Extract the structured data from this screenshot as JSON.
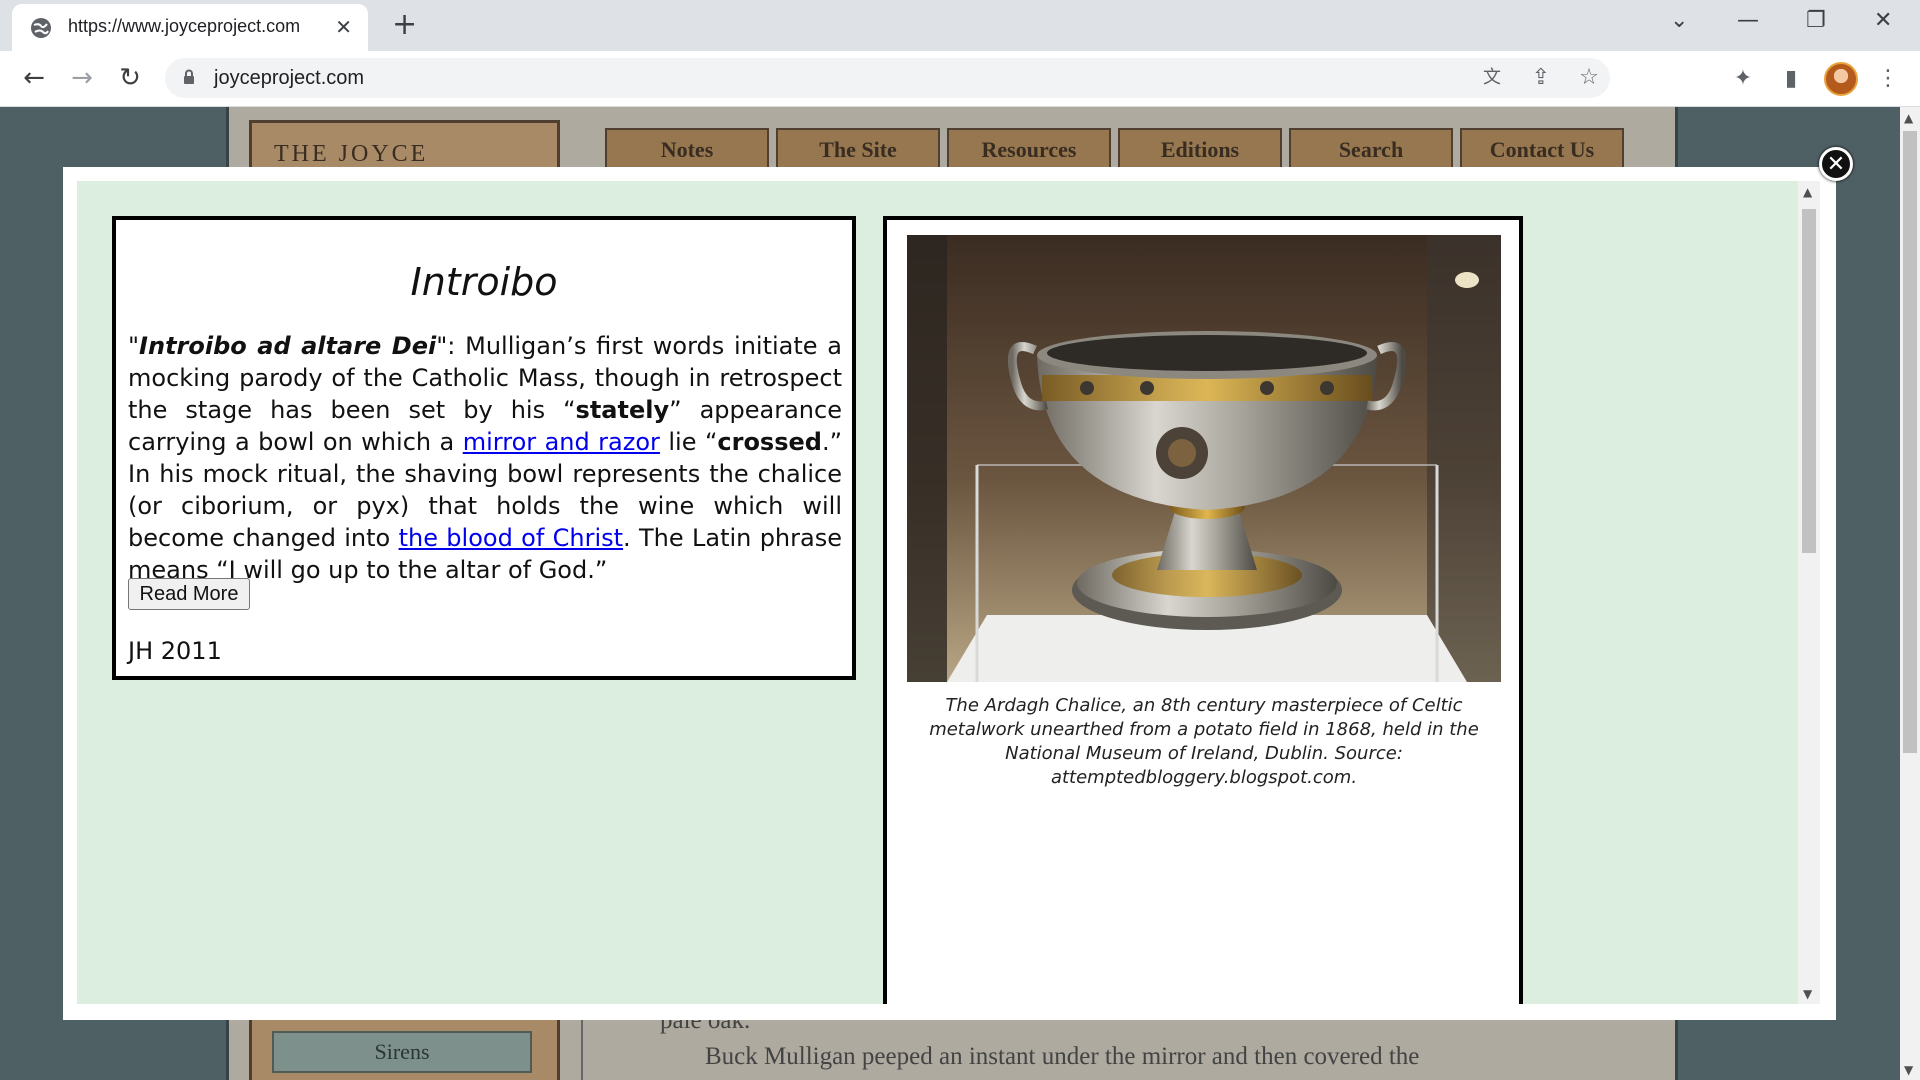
{
  "browser": {
    "tab_title": "https://www.joyceproject.com",
    "tab_close": "✕",
    "new_tab": "+",
    "url": "joyceproject.com",
    "window_controls": {
      "dropdown": "⌄",
      "minimize": "—",
      "restore": "❐",
      "close": "✕"
    },
    "nav": {
      "back": "←",
      "forward": "→",
      "reload": "↻"
    },
    "toolbar_icons": {
      "translate": "文",
      "share": "⇪",
      "bookmark": "☆",
      "extensions": "✦",
      "sidepanel": "▮",
      "menu": "⋮"
    }
  },
  "site": {
    "logo_text": "THE JOYCE PROJECT",
    "nav_tabs": [
      "Notes",
      "The Site",
      "Resources",
      "Editions",
      "Search",
      "Contact Us"
    ],
    "sidebar_button": "Sirens",
    "background_text_line1": "pale oak.",
    "background_text_line2": "Buck Mulligan peeped an instant under the mirror and then covered the"
  },
  "modal": {
    "close": "✕",
    "title": "Introibo",
    "note": {
      "quote_open": "\"",
      "quote_phrase": "Introibo ad altare Dei",
      "quote_close": "\"",
      "p1": ": Mulligan’s first words initiate a mocking parody of the Catholic Mass, though in retrospect the stage has been set by his “",
      "bold1": "stately",
      "p2": "” appearance carrying a bowl on which a ",
      "link1": "mirror and razor",
      "p3": " lie “",
      "bold2": "crossed",
      "p4": ".” In his mock ritual, the shaving bowl represents the chalice (or ciborium, or pyx) that holds the wine which will become changed into ",
      "link2": "the blood of Christ",
      "p5": ". The Latin phrase means “I will go up to the altar of God.”"
    },
    "read_more": "Read More",
    "byline": "JH 2011",
    "caption": "The Ardagh Chalice, an 8th century masterpiece of Celtic metalwork unearthed from a potato field in 1868, held in the National Museum of Ireland, Dublin. Source: attemptedbloggery.blogspot.com."
  },
  "colors": {
    "modal_background": "#dceee0",
    "link": "#0000ee",
    "nav_tab": "#c99f6b"
  }
}
